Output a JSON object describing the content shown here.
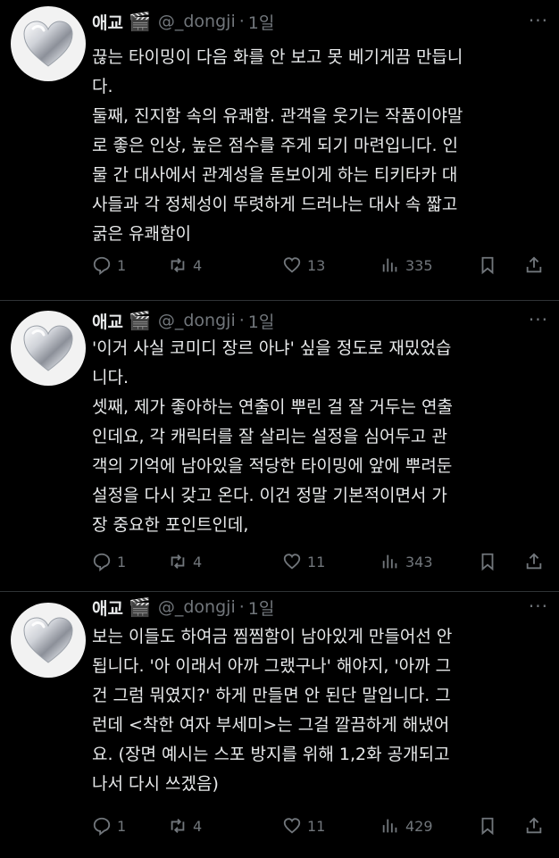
{
  "tweets": [
    {
      "display_name": "애교",
      "badge": "🎬",
      "handle": "@_dongji",
      "separator": "·",
      "time": "1일",
      "more": "···",
      "lines": [
        "끊는 타이밍이 다음 화를 안 보고 못 베기게끔 만듭니",
        "다.",
        "둘째, 진지함 속의 유쾌함. 관객을 웃기는 작품이야말",
        "로 좋은 인상, 높은 점수를 주게 되기 마련입니다. 인",
        "물 간 대사에서 관계성을 돋보이게 하는 티키타카 대",
        "사들과 각 정체성이 뚜렷하게 드러나는 대사 속 짧고",
        "굵은 유쾌함이"
      ],
      "stats": {
        "replies": "1",
        "retweets": "4",
        "likes": "13",
        "views": "335"
      }
    },
    {
      "display_name": "애교",
      "badge": "🎬",
      "handle": "@_dongji",
      "separator": "·",
      "time": "1일",
      "more": "···",
      "lines": [
        "'이거 사실 코미디 장르 아냐' 싶을 정도로 재밌었습",
        "니다.",
        "셋째, 제가 좋아하는 연출이 뿌린 걸 잘 거두는 연출",
        "인데요, 각 캐릭터를 잘 살리는 설정을 심어두고 관",
        "객의 기억에 남아있을 적당한 타이밍에 앞에 뿌려둔",
        "설정을 다시 갖고 온다. 이건 정말 기본적이면서 가",
        "장 중요한 포인트인데,"
      ],
      "stats": {
        "replies": "1",
        "retweets": "4",
        "likes": "11",
        "views": "343"
      }
    },
    {
      "display_name": "애교",
      "badge": "🎬",
      "handle": "@_dongji",
      "separator": "·",
      "time": "1일",
      "more": "···",
      "lines": [
        "보는 이들도 하여금 찜찜함이 남아있게 만들어선 안",
        "됩니다. '아 이래서 아까 그랬구나' 해야지, '아까 그",
        "건 그럼 뭐였지?' 하게 만들면 안 된단 말입니다. 그",
        "런데 <착한 여자 부세미>는 그걸 깔끔하게 해냈어",
        "요. (장면 예시는 스포 방지를 위해 1,2화 공개되고",
        "나서 다시 쓰겠음)"
      ],
      "stats": {
        "replies": "1",
        "retweets": "4",
        "likes": "11",
        "views": "429"
      }
    }
  ],
  "icons": {
    "reply": "reply-icon",
    "retweet": "retweet-icon",
    "like": "heart-icon",
    "views": "views-icon",
    "bookmark": "bookmark-icon",
    "share": "share-icon"
  },
  "colors": {
    "background": "#000000",
    "text": "#e7e9ea",
    "muted": "#71767b",
    "divider": "#2f3336"
  }
}
